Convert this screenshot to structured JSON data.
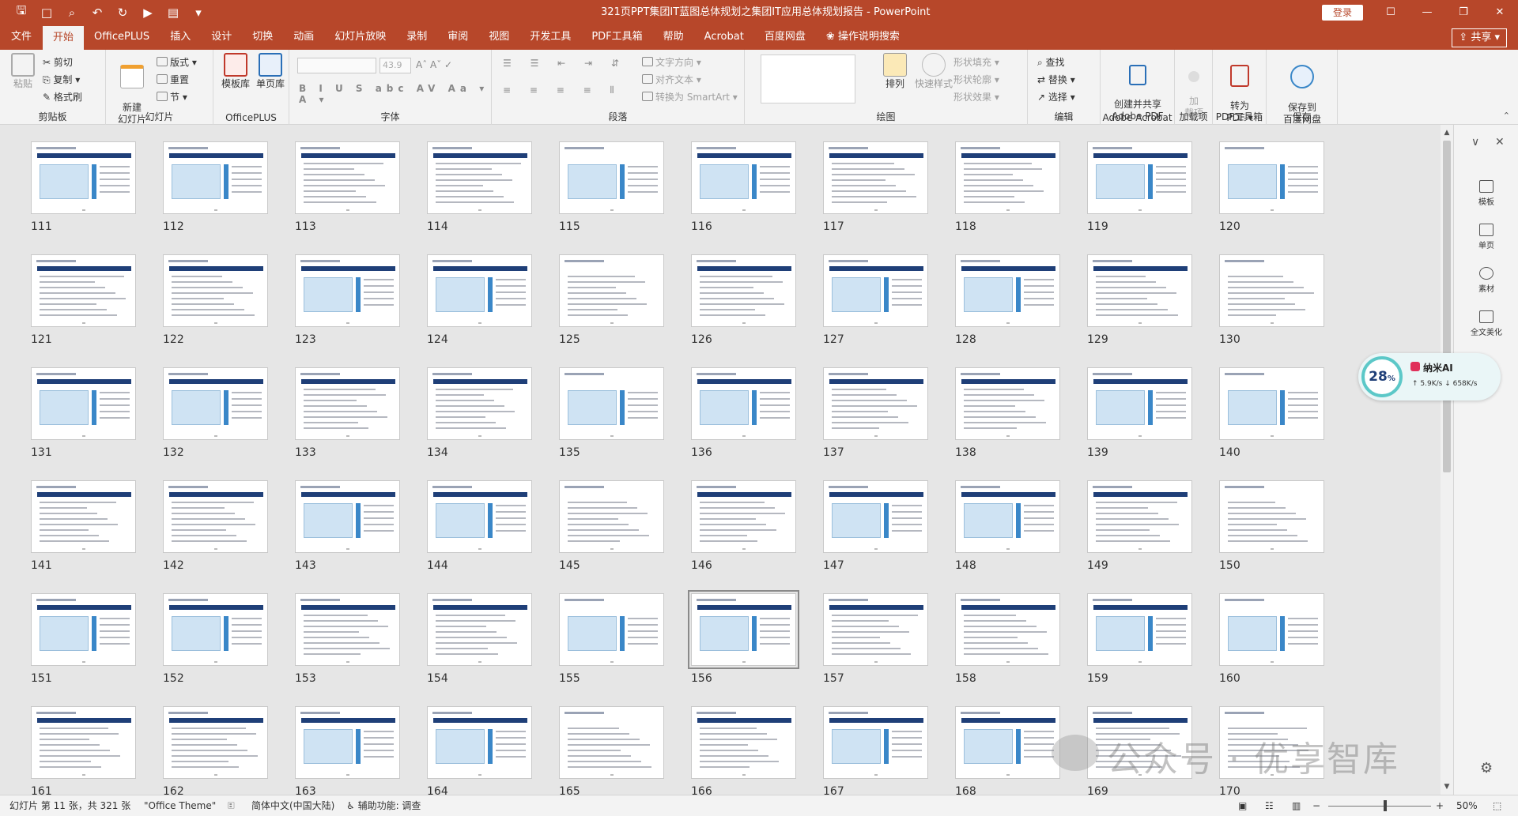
{
  "window": {
    "title": "321页PPT集团IT蓝图总体规划之集团IT应用总体规划报告  -  PowerPoint",
    "login": "登录",
    "share": "共享"
  },
  "menu": {
    "tabs": [
      "文件",
      "开始",
      "OfficePLUS",
      "插入",
      "设计",
      "切换",
      "动画",
      "幻灯片放映",
      "录制",
      "审阅",
      "视图",
      "开发工具",
      "PDF工具箱",
      "帮助",
      "Acrobat",
      "百度网盘",
      "操作说明搜索"
    ]
  },
  "ribbon": {
    "clipboard": {
      "label": "剪贴板",
      "paste": "粘贴",
      "cut": "剪切",
      "copy": "复制",
      "painter": "格式刷"
    },
    "slides": {
      "label": "幻灯片",
      "new_slide": "新建\n幻灯片",
      "layout": "版式",
      "reset": "重置",
      "section": "节"
    },
    "officeplus": {
      "label": "OfficePLUS",
      "template": "模板库",
      "single": "单页库"
    },
    "font": {
      "label": "字体",
      "size": "43.9"
    },
    "paragraph": {
      "label": "段落",
      "text_dir": "文字方向",
      "align_text": "对齐文本",
      "smartart": "转换为 SmartArt"
    },
    "drawing": {
      "label": "绘图",
      "arrange": "排列",
      "quick_styles": "快速样式",
      "fill": "形状填充",
      "outline": "形状轮廓",
      "effects": "形状效果"
    },
    "editing": {
      "label": "编辑",
      "find": "查找",
      "replace": "替换",
      "select": "选择"
    },
    "acrobat": {
      "label": "Adobe Acrobat",
      "create": "创建并共享\nAdobe PDF"
    },
    "addins": {
      "label": "加载项",
      "btn": "加\n载项"
    },
    "pdftools": {
      "label": "PDF工具箱",
      "btn": "转为\nPDF"
    },
    "save": {
      "label": "保存",
      "btn": "保存到\n百度网盘"
    }
  },
  "slides": {
    "numbers": [
      "111",
      "112",
      "113",
      "114",
      "115",
      "116",
      "117",
      "118",
      "119",
      "120",
      "121",
      "122",
      "123",
      "124",
      "125",
      "126",
      "127",
      "128",
      "129",
      "130",
      "131",
      "132",
      "133",
      "134",
      "135",
      "136",
      "137",
      "138",
      "139",
      "140",
      "141",
      "142",
      "143",
      "144",
      "145",
      "146",
      "147",
      "148",
      "149",
      "150",
      "151",
      "152",
      "153",
      "154",
      "155",
      "156",
      "157",
      "158",
      "159",
      "160",
      "161",
      "162",
      "163",
      "164",
      "165",
      "166",
      "167",
      "168",
      "169",
      "170"
    ],
    "selected": "156"
  },
  "right_pane": {
    "items": [
      "模板",
      "单页",
      "素材",
      "全文美化"
    ]
  },
  "ai_widget": {
    "percent": "28",
    "percent_sign": "%",
    "name": "纳米AI",
    "up": "5.9K/s",
    "down": "658K/s"
  },
  "watermark": "公众号 · 优享智库",
  "status": {
    "slide_info": "幻灯片 第 11 张，共 321 张",
    "theme": "\"Office Theme\"",
    "language": "简体中文(中国大陆)",
    "accessibility": "辅助功能: 调查",
    "zoom": "50%"
  }
}
